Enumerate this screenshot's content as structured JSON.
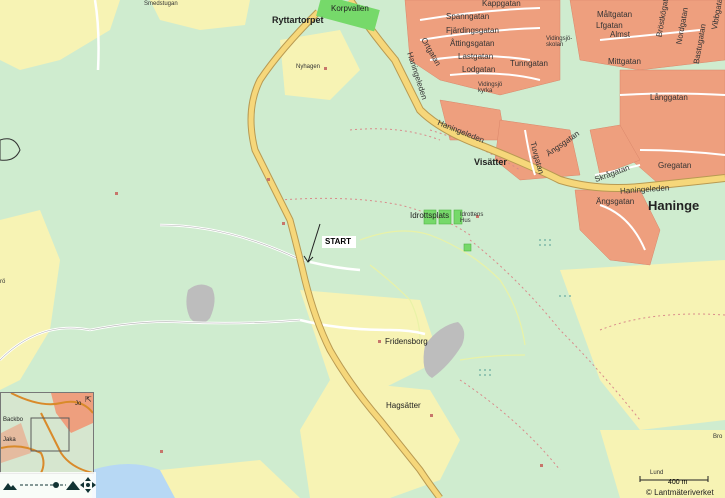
{
  "labels": {
    "smedstugan": "Smedstugan",
    "ryttartorpet": "Ryttartorpet",
    "korpvallen": "Korpvallen",
    "nyhagen": "Nyhagen",
    "spanngatan": "Spanngatan",
    "kappgatan": "Kappgatan",
    "fjardingsgatan": "Fjärdingsgatan",
    "attingsgatan": "Åttingsgatan",
    "lastgatan": "Lastgatan",
    "lodgatan": "Lodgatan",
    "tunngatan": "Tunngatan",
    "ortgatan": "Ortgatan",
    "vidingsjo_skolan": "Vidingsjö-\nskolan",
    "vidingsjo_kyrka": "Vidingsjö\nkyrka",
    "haningeleden_1": "Haningeleden",
    "haningeleden_2": "Haningeleden",
    "haningeleden_3": "Haningeleden",
    "visatter": "Visätter",
    "haninge": "Haninge",
    "idrottsplats": "Idrottsplats",
    "idrottens_hus": "Idrottens\nHus",
    "start": "START",
    "fridensborg": "Fridensborg",
    "hagsatter": "Hagsätter",
    "mantgatan": "Måltgatan",
    "lfgatan": "Lfgatan",
    "almst": "Almst",
    "mittgatan": "Mittgatan",
    "langgatan": "Långgatan",
    "gregatan": "Gregatan",
    "skragatan": "Skrågatan",
    "tuvgatan": "Tuvgatan",
    "angsgatan": "Ängsgatan",
    "vibbgatan": "Vibbgatan",
    "nordgatan": "Nordgatan",
    "bastugatan": "Bastugatan",
    "brostkogatan": "Bröstkögatan",
    "edge_ro": "rö",
    "edge_bro": "Bro",
    "edge_lund": "Lund"
  },
  "overview": {
    "label_jo": "Jo",
    "label_backbo": "Backbo",
    "label_jaka": "Jaka"
  },
  "scale": {
    "text": "400 m"
  },
  "copyright": "© Lantmäteriverket",
  "colors": {
    "forest": "#cfeccf",
    "open_land": "#f7f3b4",
    "water": "#b7d8f4",
    "urban": "#ee9f7e",
    "road": "#f6d77a",
    "road_edge": "#b89a52",
    "sports": "#76d96a"
  },
  "nav": {
    "zoom_in_icon": "mountain-small-icon",
    "zoom_out_icon": "mountain-large-icon",
    "home_icon": "home-icon",
    "pan_icon": "pan-arrows-icon"
  }
}
